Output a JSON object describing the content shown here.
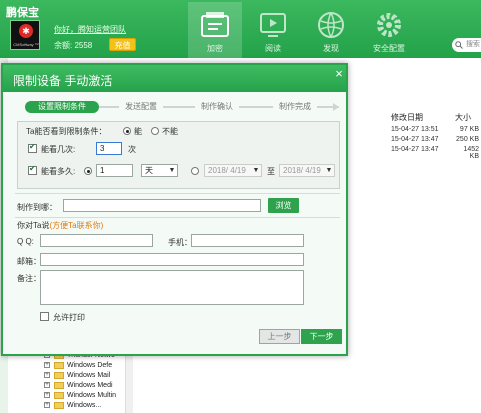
{
  "app": {
    "title": "鹏保宝",
    "greeting": "你好，腾知运营团队",
    "balance": "余额: 2558",
    "recharge_label": "充值",
    "avatar_text": "鹏保宝",
    "avatar_caption": "CMSoftway ™"
  },
  "nav": {
    "tabs": [
      {
        "label": "加密",
        "icon": "encrypt-icon",
        "active": true
      },
      {
        "label": "阅读",
        "icon": "read-icon",
        "active": false
      },
      {
        "label": "发现",
        "icon": "discover-icon",
        "active": false
      },
      {
        "label": "安全配置",
        "icon": "gear-icon",
        "active": false
      }
    ],
    "search_placeholder": "搜索"
  },
  "file_list": {
    "headers": {
      "date": "修改日期",
      "size": "大小"
    },
    "rows": [
      {
        "date": "15-04-27 13:51",
        "size": "97 KB"
      },
      {
        "date": "15-04-27 13:47",
        "size": "250 KB"
      },
      {
        "date": "15-04-27 13:47",
        "size": "1452 KB"
      }
    ]
  },
  "tree": {
    "items": [
      "Thunder Netwo",
      "Windows Defe",
      "Windows Mail",
      "Windows Medi",
      "Windows Multin",
      "Windows..."
    ]
  },
  "dialog": {
    "title": "限制设备 手动激活",
    "close_label": "×",
    "steps": [
      "设置限制条件",
      "发送配置",
      "制作确认",
      "制作完成"
    ],
    "restrict_label": "Ta能否看到限制条件：",
    "opt_yes": "能",
    "opt_no": "不能",
    "times_label": "能看几次:",
    "times_value": "3",
    "times_unit": "次",
    "duration_label": "能看多久:",
    "duration_value": "1",
    "duration_unit": "天",
    "date_from": "2018/ 4/19",
    "date_to_label": "至",
    "date_to": "2018/ 4/19",
    "save_to_label": "制作到哪：",
    "save_to_value": "",
    "browse_label": "浏览",
    "note_prefix": "你对Ta说",
    "note_highlight": "(方便Ta联系你)",
    "qq_label": "Q  Q:",
    "phone_label": "手机：",
    "email_label": "邮箱：",
    "remark_label": "备注：",
    "print_label": "允许打印",
    "prev_label": "上一步",
    "next_label": "下一步"
  },
  "colors": {
    "brand_green": "#2aa34c",
    "accent_orange": "#e07a10",
    "recharge_yellow": "#f2c11a"
  }
}
